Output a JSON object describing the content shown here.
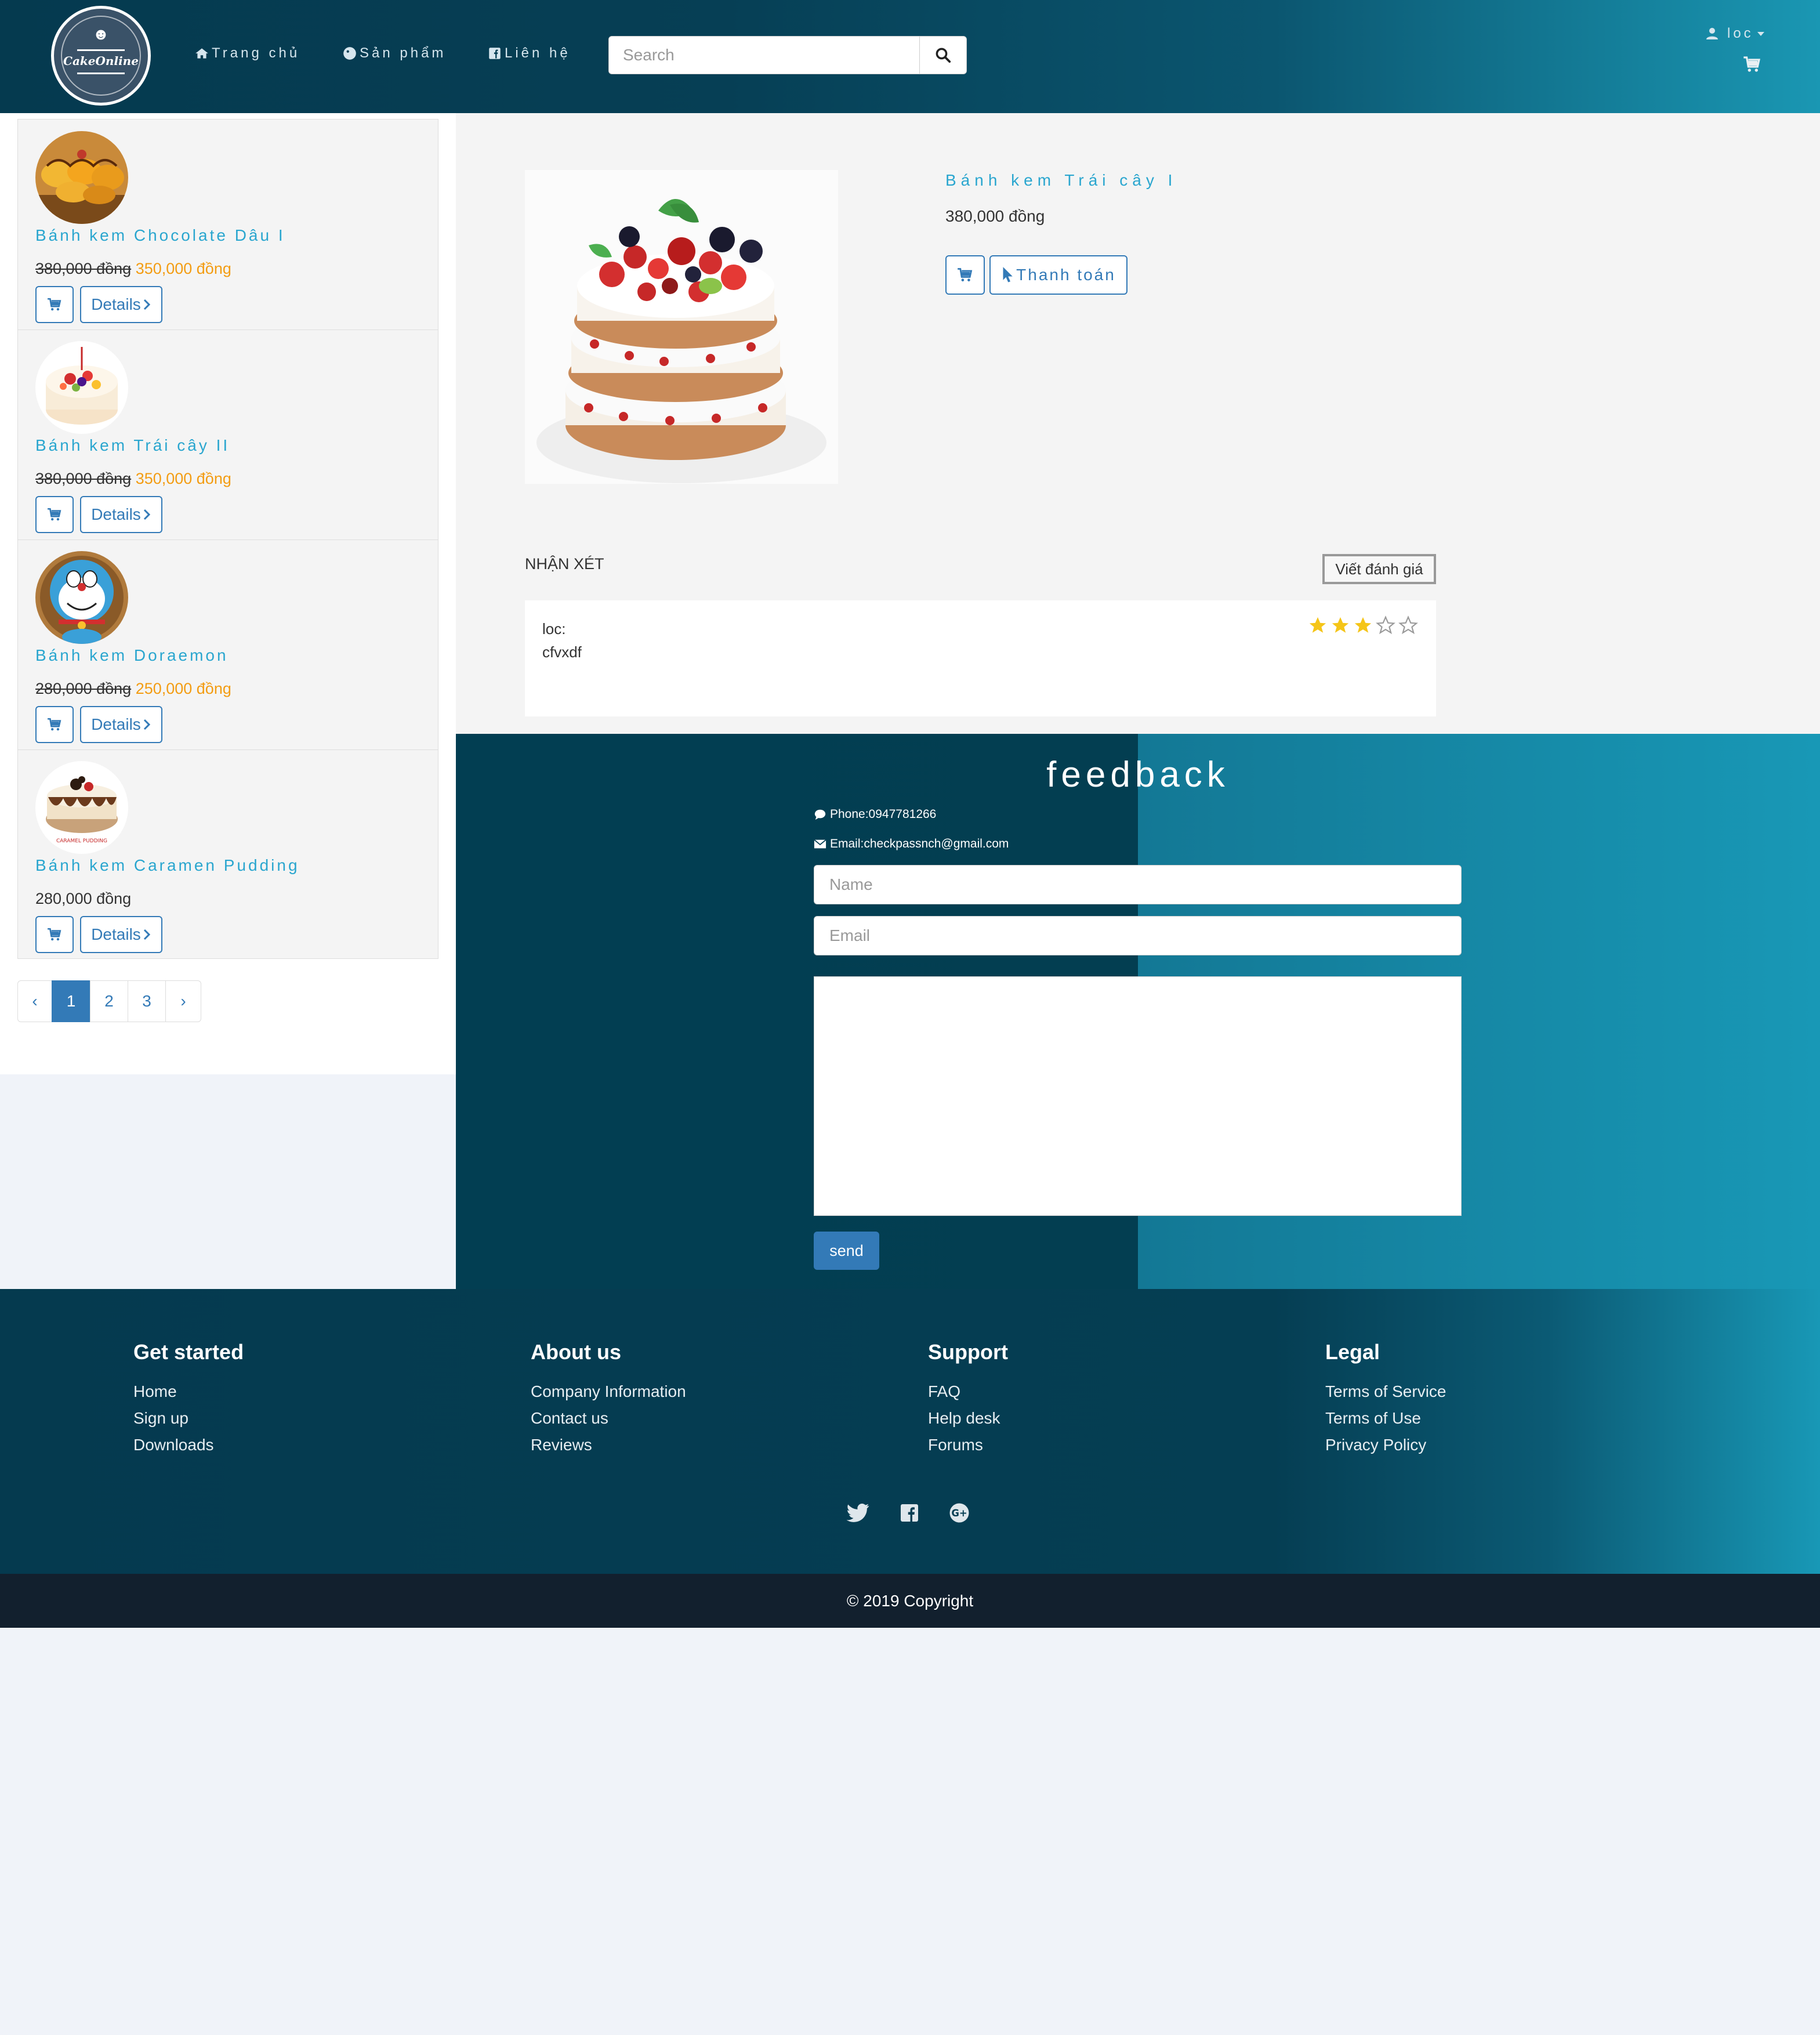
{
  "header": {
    "logo_text": "CakeOnline",
    "nav": [
      {
        "label": "Trang chủ",
        "icon": "home-icon"
      },
      {
        "label": "Sản phẩm",
        "icon": "tag-icon"
      },
      {
        "label": "Liên hệ",
        "icon": "facebook-icon"
      }
    ],
    "search": {
      "placeholder": "Search",
      "value": ""
    },
    "user_label": "loc"
  },
  "sidebar": {
    "products": [
      {
        "name": "Bánh kem Chocolate Dâu I",
        "old_price": "380,000 đồng",
        "new_price": "350,000 đồng",
        "details_label": "Details"
      },
      {
        "name": "Bánh kem Trái cây II",
        "old_price": "380,000 đồng",
        "new_price": "350,000 đồng",
        "details_label": "Details"
      },
      {
        "name": "Bánh kem Doraemon",
        "old_price": "280,000 đồng",
        "new_price": "250,000 đồng",
        "details_label": "Details"
      },
      {
        "name": "Bánh kem Caramen Pudding",
        "price": "280,000 đồng",
        "details_label": "Details",
        "image_caption": "CARAMEL PUDDING"
      }
    ],
    "pagination": {
      "prev": "‹",
      "pages": [
        "1",
        "2",
        "3"
      ],
      "next": "›",
      "active": "1"
    }
  },
  "detail": {
    "name": "Bánh kem Trái cây I",
    "price": "380,000 đồng",
    "pay_label": "Thanh toán",
    "reviews_title": "NHẬN XÉT",
    "write_review_label": "Viết đánh giá",
    "reviews": [
      {
        "user": "loc:",
        "text": "cfvxdf",
        "rating": 3,
        "max_rating": 5
      }
    ]
  },
  "feedback": {
    "title": "feedback",
    "phone": "Phone:0947781266",
    "email": "Email:checkpassnch@gmail.com",
    "name_placeholder": "Name",
    "email_placeholder": "Email",
    "send_label": "send"
  },
  "footer": {
    "columns": [
      {
        "heading": "Get started",
        "links": [
          "Home",
          "Sign up",
          "Downloads"
        ]
      },
      {
        "heading": "About us",
        "links": [
          "Company Information",
          "Contact us",
          "Reviews"
        ]
      },
      {
        "heading": "Support",
        "links": [
          "FAQ",
          "Help desk",
          "Forums"
        ]
      },
      {
        "heading": "Legal",
        "links": [
          "Terms of Service",
          "Terms of Use",
          "Privacy Policy"
        ]
      }
    ],
    "social": [
      "twitter-icon",
      "facebook-icon",
      "google-plus-icon"
    ],
    "copyright": "© 2019 Copyright"
  },
  "colors": {
    "header_dark": "#053a4f",
    "header_teal": "#1a97b3",
    "link_blue": "#337ab7",
    "product_name": "#2aa6cf",
    "sale_price": "#f39c12",
    "star": "#f5c518",
    "copyright_bar": "#12202e"
  }
}
